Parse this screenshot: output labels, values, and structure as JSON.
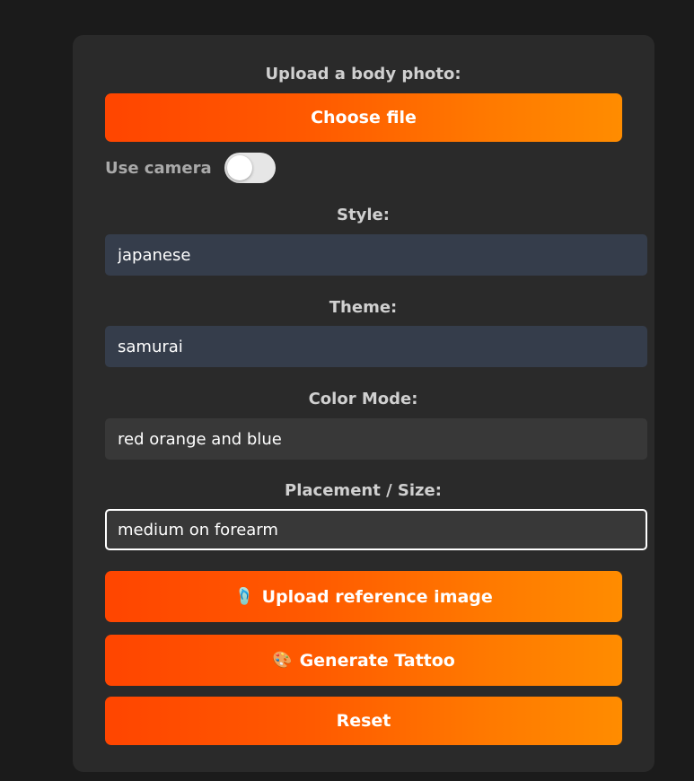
{
  "upload": {
    "label": "Upload a body photo:",
    "button_label": "Choose file"
  },
  "camera": {
    "label": "Use camera",
    "enabled": false
  },
  "style": {
    "label": "Style:",
    "value": "japanese"
  },
  "theme": {
    "label": "Theme:",
    "value": "samurai"
  },
  "color_mode": {
    "label": "Color Mode:",
    "value": "red orange and blue"
  },
  "placement": {
    "label": "Placement / Size:",
    "value": "medium on forearm"
  },
  "actions": {
    "reference_icon": "🩴",
    "reference_label": "Upload reference image",
    "generate_icon": "🎨",
    "generate_label": "Generate Tattoo",
    "reset_label": "Reset"
  },
  "colors": {
    "accent_start": "#ff4500",
    "accent_end": "#ff8c00",
    "background": "#1b1b1b",
    "card": "#2a2a2a"
  }
}
